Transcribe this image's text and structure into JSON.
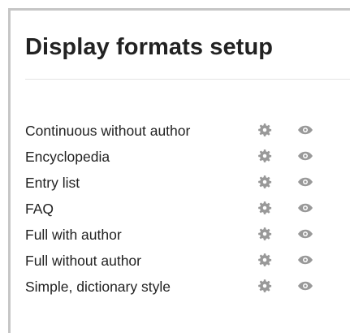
{
  "page": {
    "title": "Display formats setup"
  },
  "formats": [
    {
      "name": "Continuous without author",
      "edit_icon": "gear-icon",
      "visibility_icon": "eye-icon"
    },
    {
      "name": "Encyclopedia",
      "edit_icon": "gear-icon",
      "visibility_icon": "eye-icon"
    },
    {
      "name": "Entry list",
      "edit_icon": "gear-icon",
      "visibility_icon": "eye-icon"
    },
    {
      "name": "FAQ",
      "edit_icon": "gear-icon",
      "visibility_icon": "eye-icon"
    },
    {
      "name": "Full with author",
      "edit_icon": "gear-icon",
      "visibility_icon": "eye-icon"
    },
    {
      "name": "Full without author",
      "edit_icon": "gear-icon",
      "visibility_icon": "eye-icon"
    },
    {
      "name": "Simple, dictionary style",
      "edit_icon": "gear-icon",
      "visibility_icon": "eye-icon"
    }
  ],
  "colors": {
    "text": "#222222",
    "icon": "#999999",
    "border": "#c6c6c6",
    "divider": "#e3e3e3"
  }
}
